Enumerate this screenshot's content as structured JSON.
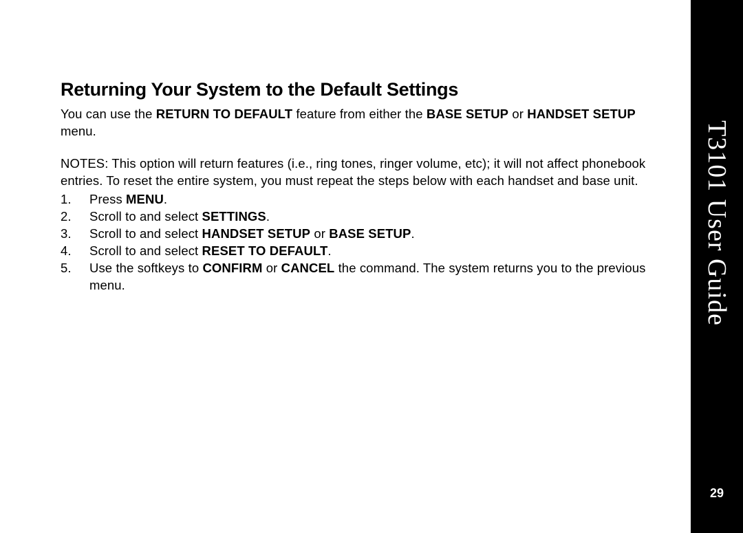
{
  "heading": "Returning Your System to the Default Settings",
  "intro": {
    "pre": "You can use the ",
    "bold1": "RETURN TO DEFAULT",
    "mid1": " feature from either the ",
    "bold2": "BASE SETUP",
    "mid2": " or ",
    "bold3": "HANDSET SETUP",
    "post": " menu."
  },
  "notes": {
    "label": "NOTES:",
    "text": " This option will return features (i.e., ring tones, ringer volume, etc); it will not affect phonebook entries. To reset the entire system, you must repeat the steps below with each handset and base unit."
  },
  "steps": [
    {
      "pre": "Press ",
      "bold1": "MENU",
      "post": "."
    },
    {
      "pre": "Scroll to and select ",
      "bold1": "SETTINGS",
      "post": "."
    },
    {
      "pre": "Scroll to and select ",
      "bold1": "HANDSET SETUP",
      "mid": " or ",
      "bold2": "BASE SETUP",
      "post": "."
    },
    {
      "pre": "Scroll to and select ",
      "bold1": "RESET TO DEFAULT",
      "post": "."
    },
    {
      "pre": "Use the softkeys to ",
      "bold1": "CONFIRM",
      "mid": " or ",
      "bold2": "CANCEL",
      "post": " the command. The system returns you to the previous menu."
    }
  ],
  "sidebar_title": "T3101 User Guide",
  "page_number": "29"
}
